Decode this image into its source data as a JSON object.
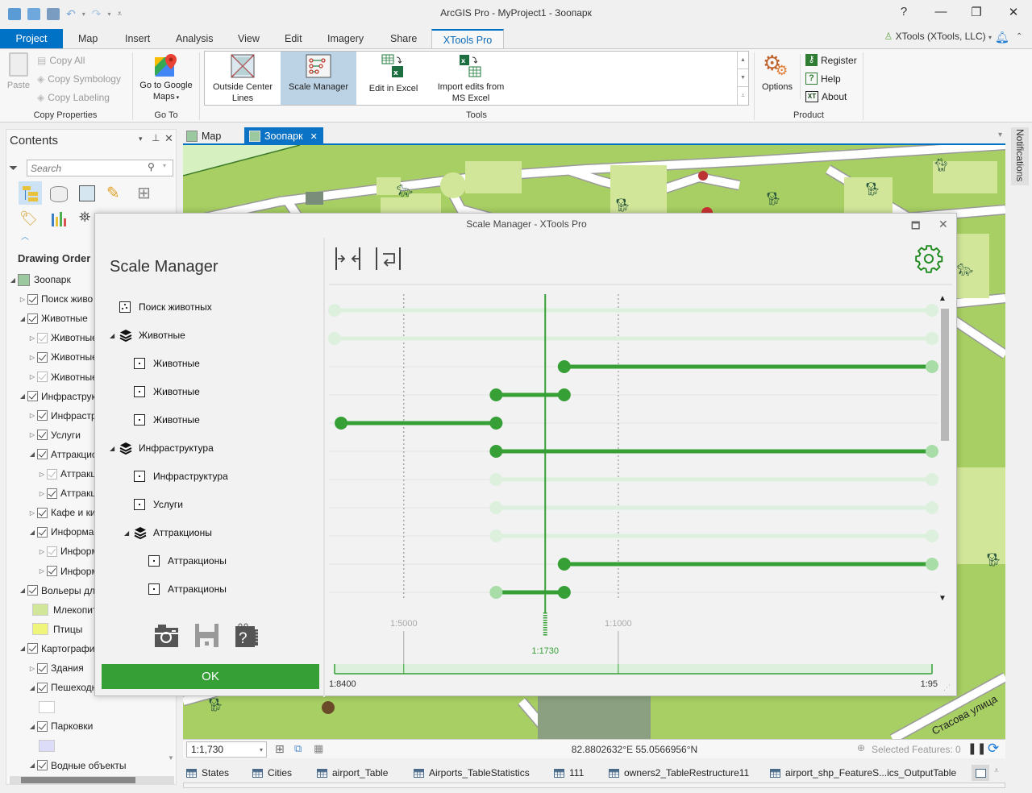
{
  "window": {
    "title": "ArcGIS Pro - MyProject1 - Зоопарк",
    "help": "?",
    "minimize": "—",
    "restore": "❐",
    "close": "✕"
  },
  "user": {
    "label": "XTools (XTools, LLC)"
  },
  "ribbon_tabs": [
    {
      "label": "Project"
    },
    {
      "label": "Map"
    },
    {
      "label": "Insert"
    },
    {
      "label": "Analysis"
    },
    {
      "label": "View"
    },
    {
      "label": "Edit"
    },
    {
      "label": "Imagery"
    },
    {
      "label": "Share"
    },
    {
      "label": "XTools Pro",
      "active": true
    }
  ],
  "ribbon": {
    "copy_properties": {
      "group_label": "Copy Properties",
      "paste": "Paste",
      "copy_all": "Copy All",
      "copy_symbology": "Copy Symbology",
      "copy_labeling": "Copy Labeling"
    },
    "go_to": {
      "group_label": "Go To",
      "google_maps_line1": "Go to Google",
      "google_maps_line2": "Maps"
    },
    "tools": {
      "group_label": "Tools",
      "outside_center_line1": "Outside Center",
      "outside_center_line2": "Lines",
      "scale_manager": "Scale Manager",
      "edit_in_excel": "Edit in Excel",
      "import_edits_line1": "Import edits from",
      "import_edits_line2": "MS Excel"
    },
    "product": {
      "group_label": "Product",
      "options": "Options",
      "register": "Register",
      "help": "Help",
      "about": "About"
    }
  },
  "contents": {
    "title": "Contents",
    "search_placeholder": "Search",
    "drawing_order": "Drawing Order",
    "tree": [
      {
        "label": "Зоопарк",
        "indent": 0,
        "type": "map"
      },
      {
        "label": "Поиск живо",
        "indent": 1,
        "expanded": false,
        "checked": true
      },
      {
        "label": "Животные",
        "indent": 1,
        "expanded": true,
        "checked": true
      },
      {
        "label": "Животные",
        "indent": 2,
        "expanded": false,
        "checked": true,
        "dim": true
      },
      {
        "label": "Животные",
        "indent": 2,
        "expanded": false,
        "checked": true
      },
      {
        "label": "Животные",
        "indent": 2,
        "expanded": false,
        "checked": true,
        "dim": true
      },
      {
        "label": "Инфраструк",
        "indent": 1,
        "expanded": true,
        "checked": true
      },
      {
        "label": "Инфрастр",
        "indent": 2,
        "expanded": false,
        "checked": true
      },
      {
        "label": "Услуги",
        "indent": 2,
        "expanded": false,
        "checked": true
      },
      {
        "label": "Аттракцио",
        "indent": 2,
        "expanded": true,
        "checked": true
      },
      {
        "label": "Аттракц",
        "indent": 3,
        "expanded": false,
        "checked": true,
        "dim": true
      },
      {
        "label": "Аттракц",
        "indent": 3,
        "expanded": false,
        "checked": true
      },
      {
        "label": "Кафе и ки",
        "indent": 2,
        "expanded": false,
        "checked": true
      },
      {
        "label": "Информа",
        "indent": 2,
        "expanded": true,
        "checked": true
      },
      {
        "label": "Информ",
        "indent": 3,
        "expanded": false,
        "checked": true,
        "dim": true
      },
      {
        "label": "Информ",
        "indent": 3,
        "expanded": false,
        "checked": true
      },
      {
        "label": "Вольеры дл",
        "indent": 1,
        "expanded": true,
        "checked": true
      },
      {
        "label": "Млекопит",
        "indent": 2,
        "type": "swatch",
        "color": "#d2e69a"
      },
      {
        "label": "Птицы",
        "indent": 2,
        "type": "swatch",
        "color": "#eef57a"
      },
      {
        "label": "Картографи",
        "indent": 1,
        "expanded": true,
        "checked": true
      },
      {
        "label": "Здания",
        "indent": 2,
        "expanded": false,
        "checked": true
      },
      {
        "label": "Пешеходн",
        "indent": 2,
        "expanded": true,
        "checked": true
      },
      {
        "label": "",
        "indent": 3,
        "type": "swatch",
        "color": "#ffffff"
      },
      {
        "label": "Парковки",
        "indent": 2,
        "expanded": true,
        "checked": true
      },
      {
        "label": "",
        "indent": 3,
        "type": "swatch",
        "color": "#dcdcf8"
      },
      {
        "label": "Водные объекты",
        "indent": 2,
        "expanded": true,
        "checked": true
      }
    ]
  },
  "doc_tabs": [
    {
      "label": "Map",
      "active": false
    },
    {
      "label": "Зоопарк",
      "active": true
    }
  ],
  "notifications": {
    "label": "Notifications"
  },
  "dialog": {
    "title": "Scale Manager  -  XTools Pro",
    "heading": "Scale Manager",
    "ok_label": "OK",
    "layers": [
      {
        "label": "Поиск животных",
        "level": 0,
        "kind": "points",
        "min_scale": 8400,
        "max_scale": 95,
        "active": false
      },
      {
        "label": "Животные",
        "level": 0,
        "kind": "group",
        "expanded": true,
        "min_scale": 8400,
        "max_scale": 95,
        "active": false
      },
      {
        "label": "Животные",
        "level": 1,
        "kind": "point",
        "min_scale": 1500,
        "max_scale": 95,
        "active": true
      },
      {
        "label": "Животные",
        "level": 1,
        "kind": "point",
        "min_scale": 2500,
        "max_scale": 1500,
        "active": true
      },
      {
        "label": "Животные",
        "level": 1,
        "kind": "point",
        "min_scale": 8000,
        "max_scale": 2500,
        "active": true
      },
      {
        "label": "Инфраструктура",
        "level": 0,
        "kind": "group",
        "expanded": true,
        "min_scale": 2500,
        "max_scale": 95,
        "active": true
      },
      {
        "label": "Инфраструктура",
        "level": 1,
        "kind": "point",
        "min_scale": 2500,
        "max_scale": 95,
        "active": false
      },
      {
        "label": "Услуги",
        "level": 1,
        "kind": "point",
        "min_scale": 2500,
        "max_scale": 95,
        "active": false
      },
      {
        "label": "Аттракционы",
        "level": 1,
        "kind": "group",
        "expanded": true,
        "min_scale": 2500,
        "max_scale": 95,
        "active": false
      },
      {
        "label": "Аттракционы",
        "level": 2,
        "kind": "point",
        "min_scale": 1500,
        "max_scale": 95,
        "active": true
      },
      {
        "label": "Аттракционы",
        "level": 2,
        "kind": "point",
        "min_scale": 2500,
        "max_scale": 1500,
        "active": true,
        "min_dim": true
      }
    ],
    "scale_axis": {
      "min_label": "1:8400",
      "max_label": "1:95",
      "min_scale": 8400,
      "max_scale": 95,
      "ticks": [
        {
          "label": "1:5000",
          "scale": 5000
        },
        {
          "label": "1:1000",
          "scale": 1000
        }
      ],
      "current": {
        "label": "1:1730",
        "scale": 1730
      }
    },
    "colors": {
      "accent": "#36a036",
      "inactive": "#ddf0dd",
      "handle_light": "#a8dda8"
    }
  },
  "statusbar": {
    "scale_value": "1:1,730",
    "coordinates": "82.8802632°E 55.0566956°N",
    "selected_features": "Selected Features: 0"
  },
  "table_tabs": [
    {
      "label": "States"
    },
    {
      "label": "Cities"
    },
    {
      "label": "airport_Table"
    },
    {
      "label": "Airports_TableStatistics"
    },
    {
      "label": "111"
    },
    {
      "label": "owners2_TableRestructure11"
    },
    {
      "label": "airport_shp_FeatureS...ics_OutputTable"
    }
  ],
  "map_labels": {
    "street": "Стасова улица"
  }
}
